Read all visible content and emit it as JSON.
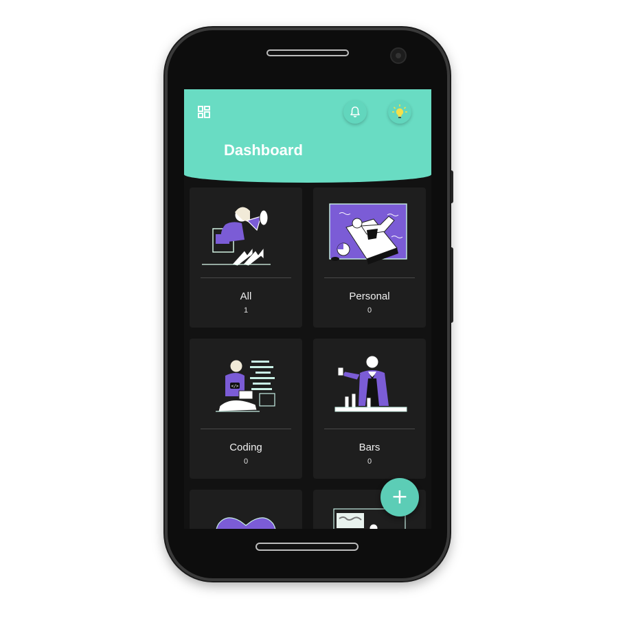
{
  "app": {
    "title": "Dashboard"
  },
  "colors": {
    "accent": "#69dcc3",
    "card_bg": "#1e1e1e",
    "illustration": "#7b5cd6"
  },
  "header": {
    "menu_icon": "dashboard-grid-icon",
    "notification_icon": "bell-icon",
    "theme_icon": "lightbulb-icon"
  },
  "categories": [
    {
      "label": "All",
      "count": "1"
    },
    {
      "label": "Personal",
      "count": "0"
    },
    {
      "label": "Coding",
      "count": "0"
    },
    {
      "label": "Bars",
      "count": "0"
    },
    {
      "label": "",
      "count": ""
    },
    {
      "label": "",
      "count": ""
    }
  ],
  "fab": {
    "label": "+"
  }
}
